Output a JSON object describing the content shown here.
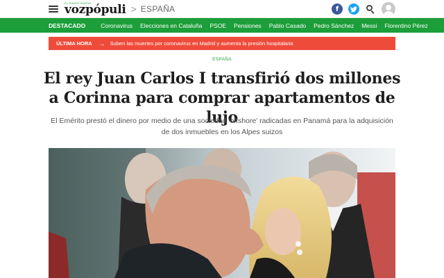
{
  "header": {
    "logo_tagline": "EL DIARIO DIGITAL",
    "logo_text": "vozpópuli",
    "breadcrumb_separator": ">",
    "section": "ESPAÑA",
    "social": {
      "facebook_glyph": "f",
      "twitter_glyph": "t"
    }
  },
  "nav": {
    "label": "DESTACADO",
    "items": [
      "Coronavirus",
      "Elecciones en Cataluña",
      "PSOE",
      "Pensiones",
      "Pablo Casado",
      "Pedro Sánchez",
      "Messi",
      "Florentino Pérez"
    ]
  },
  "alert": {
    "label": "ÚLTIMA HORA",
    "arrow": "→",
    "text": "Suben las muertes por coronavirus en Madrid y aumenta la presión hospitalaria"
  },
  "article": {
    "section": "ESPAÑA",
    "headline": "El rey Juan Carlos I transfirió dos millones a Corinna para comprar apartamentos de lujo",
    "subtitle": "El Emérito prestó el dinero por medio de una sociedad 'offshore' radicadas en Panamá para la adquisición de dos inmuebles en los Alpes suizos"
  },
  "colors": {
    "brand_green": "#1c9e3a",
    "alert_red": "#ef4b3b",
    "facebook_blue": "#3b5998",
    "twitter_blue": "#1da1f2"
  }
}
